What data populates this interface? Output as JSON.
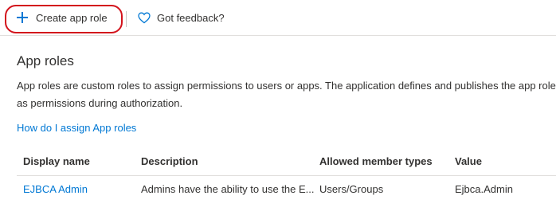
{
  "toolbar": {
    "create_label": "Create app role",
    "feedback_label": "Got feedback?"
  },
  "section": {
    "title": "App roles",
    "description_line1": "App roles are custom roles to assign permissions to users or apps. The application defines and publishes the app roles",
    "description_line2": "as permissions during authorization.",
    "help_link": "How do I assign App roles"
  },
  "table": {
    "headers": [
      "Display name",
      "Description",
      "Allowed member types",
      "Value"
    ],
    "rows": [
      {
        "display_name": "EJBCA Admin",
        "description": "Admins have the ability to use the E...",
        "allowed_member_types": "Users/Groups",
        "value": "Ejbca.Admin"
      }
    ]
  },
  "colors": {
    "accent": "#0078d4",
    "highlight": "#d3131c",
    "text": "#323130"
  },
  "icons": [
    "plus-icon",
    "heart-icon"
  ]
}
